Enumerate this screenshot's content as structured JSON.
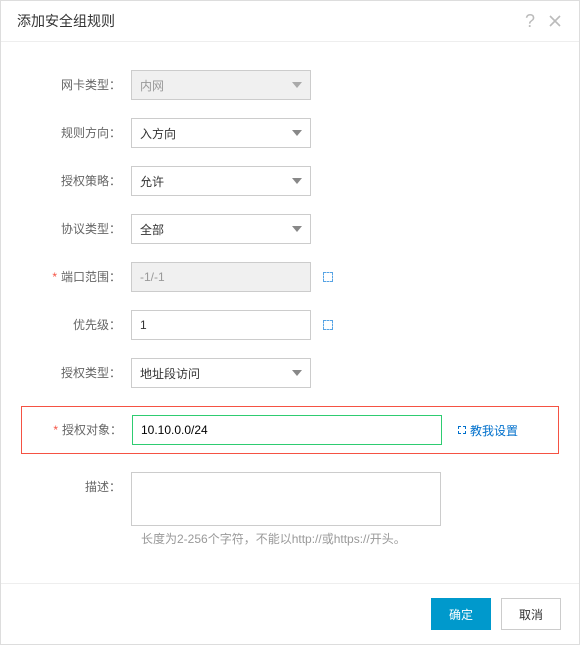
{
  "dialog": {
    "title": "添加安全组规则",
    "ok": "确定",
    "cancel": "取消"
  },
  "labels": {
    "nic_type": "网卡类型：",
    "direction": "规则方向：",
    "policy": "授权策略：",
    "protocol": "协议类型：",
    "port_range": "端口范围：",
    "priority": "优先级：",
    "auth_type": "授权类型：",
    "auth_object": "授权对象：",
    "description": "描述："
  },
  "values": {
    "nic_type": "内网",
    "direction": "入方向",
    "policy": "允许",
    "protocol": "全部",
    "port_range": "-1/-1",
    "priority": "1",
    "auth_type": "地址段访问",
    "auth_object": "10.10.0.0/24",
    "description": ""
  },
  "links": {
    "teach_me": "教我设置"
  },
  "hints": {
    "description": "长度为2-256个字符，不能以http://或https://开头。"
  }
}
